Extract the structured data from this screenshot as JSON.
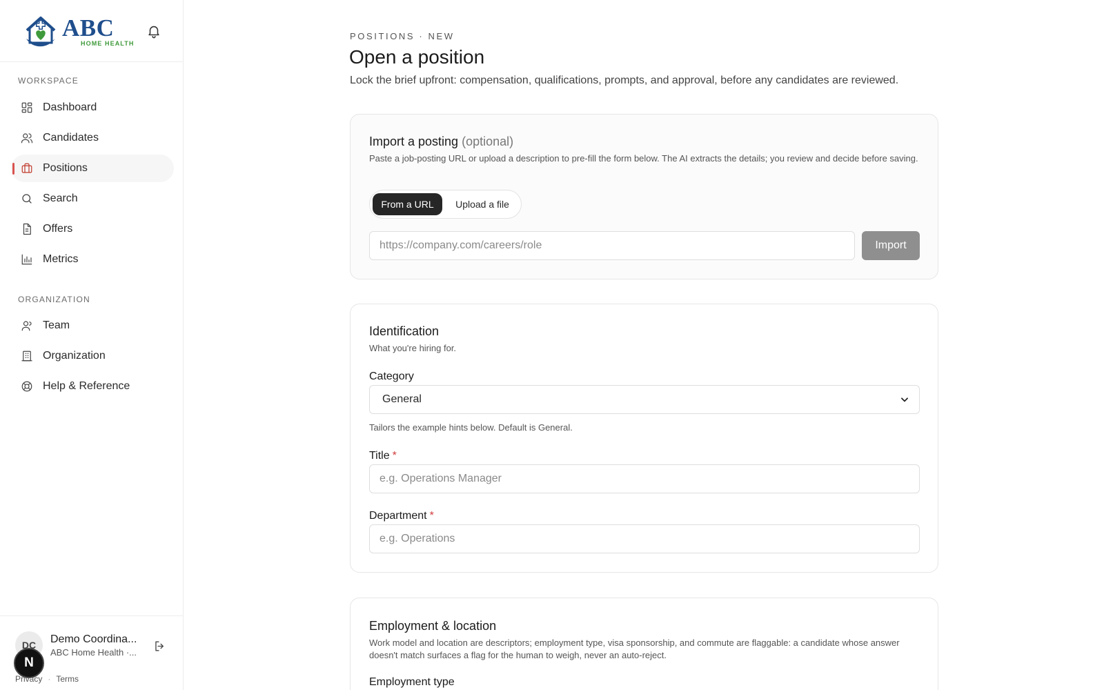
{
  "brand": {
    "name": "ABC",
    "tagline": "HOME HEALTH"
  },
  "sidebar": {
    "workspace_label": "WORKSPACE",
    "workspace_items": [
      {
        "label": "Dashboard",
        "icon": "dashboard-icon"
      },
      {
        "label": "Candidates",
        "icon": "users-icon"
      },
      {
        "label": "Positions",
        "icon": "briefcase-icon",
        "active": true
      },
      {
        "label": "Search",
        "icon": "search-icon"
      },
      {
        "label": "Offers",
        "icon": "document-icon"
      },
      {
        "label": "Metrics",
        "icon": "bar-chart-icon"
      }
    ],
    "organization_label": "ORGANIZATION",
    "organization_items": [
      {
        "label": "Team",
        "icon": "user-icon"
      },
      {
        "label": "Organization",
        "icon": "building-icon"
      },
      {
        "label": "Help & Reference",
        "icon": "lifebuoy-icon"
      }
    ],
    "user": {
      "initials": "DC",
      "name": "Demo Coordina...",
      "org": "ABC Home Health ·...",
      "badge": "N"
    },
    "footer": {
      "privacy": "Privacy",
      "terms": "Terms"
    }
  },
  "header": {
    "breadcrumb": "POSITIONS · NEW",
    "title": "Open a position",
    "subtitle": "Lock the brief upfront: compensation, qualifications, prompts, and approval, before any candidates are reviewed."
  },
  "import_card": {
    "title": "Import a posting",
    "optional": "(optional)",
    "description": "Paste a job-posting URL or upload a description to pre-fill the form below. The AI extracts the details; you review and decide before saving.",
    "tabs": [
      "From a URL",
      "Upload a file"
    ],
    "active_tab": "From a URL",
    "url_placeholder": "https://company.com/careers/role",
    "import_label": "Import"
  },
  "identification": {
    "title": "Identification",
    "description": "What you're hiring for.",
    "category_label": "Category",
    "category_value": "General",
    "category_hint": "Tailors the example hints below. Default is General.",
    "title_label": "Title",
    "title_placeholder": "e.g. Operations Manager",
    "department_label": "Department",
    "department_placeholder": "e.g. Operations",
    "required_mark": "*"
  },
  "employment": {
    "title": "Employment & location",
    "description": "Work model and location are descriptors; employment type, visa sponsorship, and commute are flaggable: a candidate whose answer doesn't match surfaces a flag for the human to weigh, never an auto-reject.",
    "employment_type_label": "Employment type"
  },
  "colors": {
    "accent": "#d9534f",
    "brand_blue": "#1f4e8c",
    "brand_green": "#3f9a3b",
    "primary_dark": "#262626"
  }
}
